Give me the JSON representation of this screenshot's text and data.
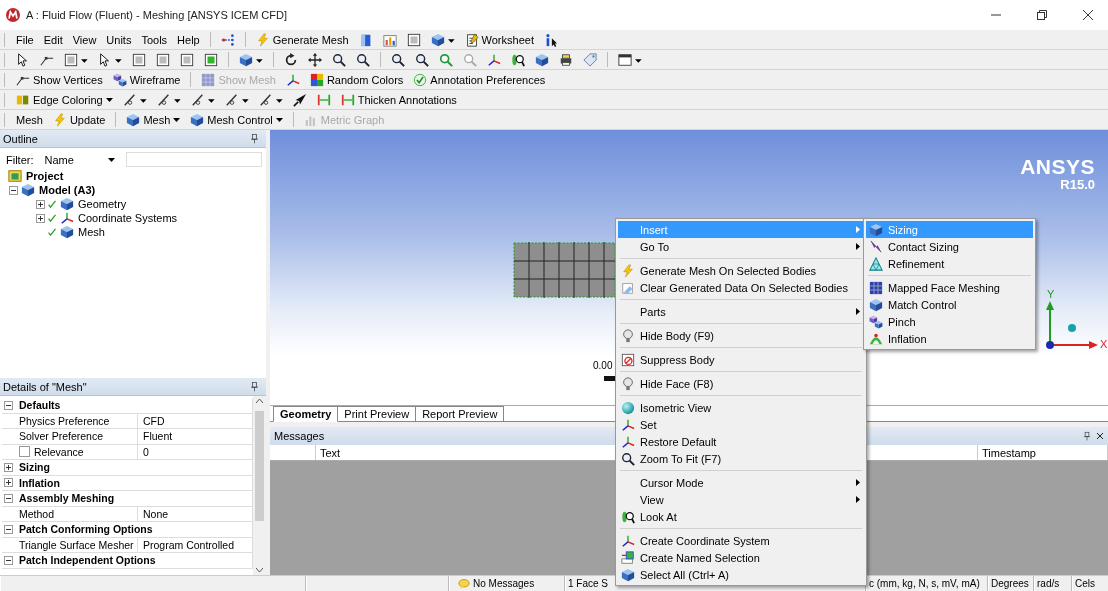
{
  "window": {
    "title": "A : Fluid Flow (Fluent) - Meshing [ANSYS ICEM CFD]"
  },
  "toolbars": [
    {
      "items": [
        {
          "kind": "menu",
          "label": "File"
        },
        {
          "kind": "menu",
          "label": "Edit"
        },
        {
          "kind": "menu",
          "label": "View"
        },
        {
          "kind": "menu",
          "label": "Units"
        },
        {
          "kind": "menu",
          "label": "Tools"
        },
        {
          "kind": "menu",
          "label": "Help"
        },
        {
          "kind": "separator"
        },
        {
          "kind": "icon",
          "dropdown": false
        },
        {
          "kind": "separator"
        },
        {
          "kind": "button",
          "label": "Generate Mesh",
          "dropdown": false,
          "disabled": false
        },
        {
          "kind": "icon",
          "dropdown": false
        },
        {
          "kind": "icon",
          "dropdown": false
        },
        {
          "kind": "icon",
          "dropdown": false
        },
        {
          "kind": "icon",
          "dropdown": true
        },
        {
          "kind": "button",
          "label": "Worksheet",
          "dropdown": false,
          "disabled": false
        },
        {
          "kind": "icon",
          "dropdown": false
        }
      ]
    },
    {
      "items": [
        {
          "kind": "icon",
          "dropdown": false
        },
        {
          "kind": "icon",
          "dropdown": false
        },
        {
          "kind": "icon",
          "dropdown": true
        },
        {
          "kind": "icon",
          "dropdown": true
        },
        {
          "kind": "icon",
          "dropdown": false
        },
        {
          "kind": "icon",
          "dropdown": false
        },
        {
          "kind": "icon",
          "dropdown": false
        },
        {
          "kind": "icon",
          "dropdown": false
        },
        {
          "kind": "separator"
        },
        {
          "kind": "icon",
          "dropdown": true
        },
        {
          "kind": "separator"
        },
        {
          "kind": "icon",
          "dropdown": false
        },
        {
          "kind": "icon",
          "dropdown": false
        },
        {
          "kind": "icon",
          "dropdown": false
        },
        {
          "kind": "icon",
          "dropdown": false
        },
        {
          "kind": "separator"
        },
        {
          "kind": "icon",
          "dropdown": false
        },
        {
          "kind": "icon",
          "dropdown": false
        },
        {
          "kind": "icon",
          "dropdown": false
        },
        {
          "kind": "icon",
          "dropdown": false
        },
        {
          "kind": "icon",
          "dropdown": false
        },
        {
          "kind": "icon",
          "dropdown": false
        },
        {
          "kind": "icon",
          "dropdown": false
        },
        {
          "kind": "icon",
          "dropdown": false
        },
        {
          "kind": "icon",
          "dropdown": false
        },
        {
          "kind": "separator"
        },
        {
          "kind": "icon",
          "dropdown": true
        }
      ]
    },
    {
      "items": [
        {
          "kind": "button",
          "label": "Show Vertices",
          "dropdown": false,
          "disabled": false
        },
        {
          "kind": "button",
          "label": "Wireframe",
          "dropdown": false,
          "disabled": false
        },
        {
          "kind": "separator"
        },
        {
          "kind": "button",
          "label": "Show Mesh",
          "dropdown": false,
          "disabled": true
        },
        {
          "kind": "icon",
          "dropdown": false
        },
        {
          "kind": "button",
          "label": "Random Colors",
          "dropdown": false,
          "disabled": false
        },
        {
          "kind": "button",
          "label": "Annotation Preferences",
          "dropdown": false,
          "disabled": false
        }
      ]
    },
    {
      "items": [
        {
          "kind": "button",
          "label": "Edge Coloring",
          "dropdown": true,
          "disabled": false
        },
        {
          "kind": "icon",
          "dropdown": true
        },
        {
          "kind": "icon",
          "dropdown": true
        },
        {
          "kind": "icon",
          "dropdown": true
        },
        {
          "kind": "icon",
          "dropdown": true
        },
        {
          "kind": "icon",
          "dropdown": true
        },
        {
          "kind": "icon",
          "dropdown": false
        },
        {
          "kind": "icon",
          "dropdown": false
        },
        {
          "kind": "button",
          "label": "Thicken Annotations",
          "dropdown": false,
          "disabled": false
        }
      ]
    },
    {
      "items": [
        {
          "kind": "button",
          "label": "Mesh",
          "dropdown": false,
          "disabled": false
        },
        {
          "kind": "button",
          "label": "Update",
          "dropdown": false,
          "disabled": false
        },
        {
          "kind": "separator"
        },
        {
          "kind": "button",
          "label": "Mesh",
          "dropdown": true,
          "disabled": false
        },
        {
          "kind": "button",
          "label": "Mesh Control",
          "dropdown": true,
          "disabled": false
        },
        {
          "kind": "separator"
        },
        {
          "kind": "button",
          "label": "Metric Graph",
          "dropdown": false,
          "disabled": true
        }
      ]
    }
  ],
  "outline": {
    "title": "Outline",
    "filter_label": "Filter:",
    "filter_value": "Name",
    "tree": [
      {
        "label": "Project",
        "children": [
          {
            "label": "Model (A3)",
            "expanded": true,
            "children": [
              {
                "label": "Geometry",
                "expanded": false
              },
              {
                "label": "Coordinate Systems",
                "expanded": false
              },
              {
                "label": "Mesh"
              }
            ]
          }
        ]
      }
    ]
  },
  "details": {
    "title": "Details of \"Mesh\"",
    "rows": [
      {
        "kind": "group",
        "label": "Defaults",
        "expanded": true
      },
      {
        "kind": "property",
        "name": "Physics Preference",
        "value": "CFD"
      },
      {
        "kind": "property",
        "name": "Solver Preference",
        "value": "Fluent"
      },
      {
        "kind": "property",
        "name": "Relevance",
        "value": "0",
        "checked": false
      },
      {
        "kind": "group",
        "label": "Sizing",
        "expanded": false
      },
      {
        "kind": "group",
        "label": "Inflation",
        "expanded": false
      },
      {
        "kind": "group",
        "label": "Assembly Meshing",
        "expanded": true
      },
      {
        "kind": "property",
        "name": "Method",
        "value": "None"
      },
      {
        "kind": "group",
        "label": "Patch Conforming Options",
        "expanded": true
      },
      {
        "kind": "property",
        "name": "Triangle Surface Mesher",
        "value": "Program Controlled"
      },
      {
        "kind": "group",
        "label": "Patch Independent Options",
        "expanded": true
      }
    ]
  },
  "viewport": {
    "logo": "ANSYS",
    "version": "R15.0",
    "scale_label": "0.00",
    "axes": [
      "Y",
      "X"
    ]
  },
  "tabs": [
    {
      "label": "Geometry",
      "selected": true
    },
    {
      "label": "Print Preview",
      "selected": false
    },
    {
      "label": "Report Preview",
      "selected": false
    }
  ],
  "messages": {
    "title": "Messages",
    "columns": [
      "Text",
      "Timestamp"
    ]
  },
  "status_bar": {
    "messages": "No Messages",
    "selection": "1 Face S",
    "units": [
      "c (mm, kg, N, s, mV, mA)",
      "Degrees",
      "rad/s",
      "Cels"
    ]
  },
  "context_menu": {
    "items": [
      {
        "kind": "item",
        "label": "Insert",
        "submenu": true,
        "selected": true
      },
      {
        "kind": "item",
        "label": "Go To",
        "submenu": true,
        "selected": false
      },
      {
        "kind": "separator"
      },
      {
        "kind": "item",
        "label": "Generate Mesh On Selected Bodies",
        "submenu": false,
        "selected": false
      },
      {
        "kind": "item",
        "label": "Clear Generated Data On Selected Bodies",
        "submenu": false,
        "selected": false
      },
      {
        "kind": "separator"
      },
      {
        "kind": "item",
        "label": "Parts",
        "submenu": true,
        "selected": false
      },
      {
        "kind": "separator"
      },
      {
        "kind": "item",
        "label": "Hide Body (F9)",
        "submenu": false,
        "selected": false
      },
      {
        "kind": "separator"
      },
      {
        "kind": "item",
        "label": "Suppress Body",
        "submenu": false,
        "selected": false
      },
      {
        "kind": "separator"
      },
      {
        "kind": "item",
        "label": "Hide Face (F8)",
        "submenu": false,
        "selected": false
      },
      {
        "kind": "separator"
      },
      {
        "kind": "item",
        "label": "Isometric View",
        "submenu": false,
        "selected": false
      },
      {
        "kind": "item",
        "label": "Set",
        "submenu": false,
        "selected": false
      },
      {
        "kind": "item",
        "label": "Restore Default",
        "submenu": false,
        "selected": false
      },
      {
        "kind": "item",
        "label": "Zoom To Fit (F7)",
        "submenu": false,
        "selected": false
      },
      {
        "kind": "separator"
      },
      {
        "kind": "item",
        "label": "Cursor Mode",
        "submenu": true,
        "selected": false
      },
      {
        "kind": "item",
        "label": "View",
        "submenu": true,
        "selected": false
      },
      {
        "kind": "item",
        "label": "Look At",
        "submenu": false,
        "selected": false
      },
      {
        "kind": "separator"
      },
      {
        "kind": "item",
        "label": "Create Coordinate System",
        "submenu": false,
        "selected": false
      },
      {
        "kind": "item",
        "label": "Create Named Selection",
        "submenu": false,
        "selected": false
      },
      {
        "kind": "item",
        "label": "Select All (Ctrl+ A)",
        "submenu": false,
        "selected": false
      }
    ]
  },
  "submenu": {
    "items": [
      {
        "kind": "item",
        "label": "Sizing",
        "submenu": false,
        "selected": true
      },
      {
        "kind": "item",
        "label": "Contact Sizing",
        "submenu": false,
        "selected": false
      },
      {
        "kind": "item",
        "label": "Refinement",
        "submenu": false,
        "selected": false
      },
      {
        "kind": "separator"
      },
      {
        "kind": "item",
        "label": "Mapped Face Meshing",
        "submenu": false,
        "selected": false
      },
      {
        "kind": "item",
        "label": "Match Control",
        "submenu": false,
        "selected": false
      },
      {
        "kind": "item",
        "label": "Pinch",
        "submenu": false,
        "selected": false
      },
      {
        "kind": "item",
        "label": "Inflation",
        "submenu": false,
        "selected": false
      }
    ]
  }
}
